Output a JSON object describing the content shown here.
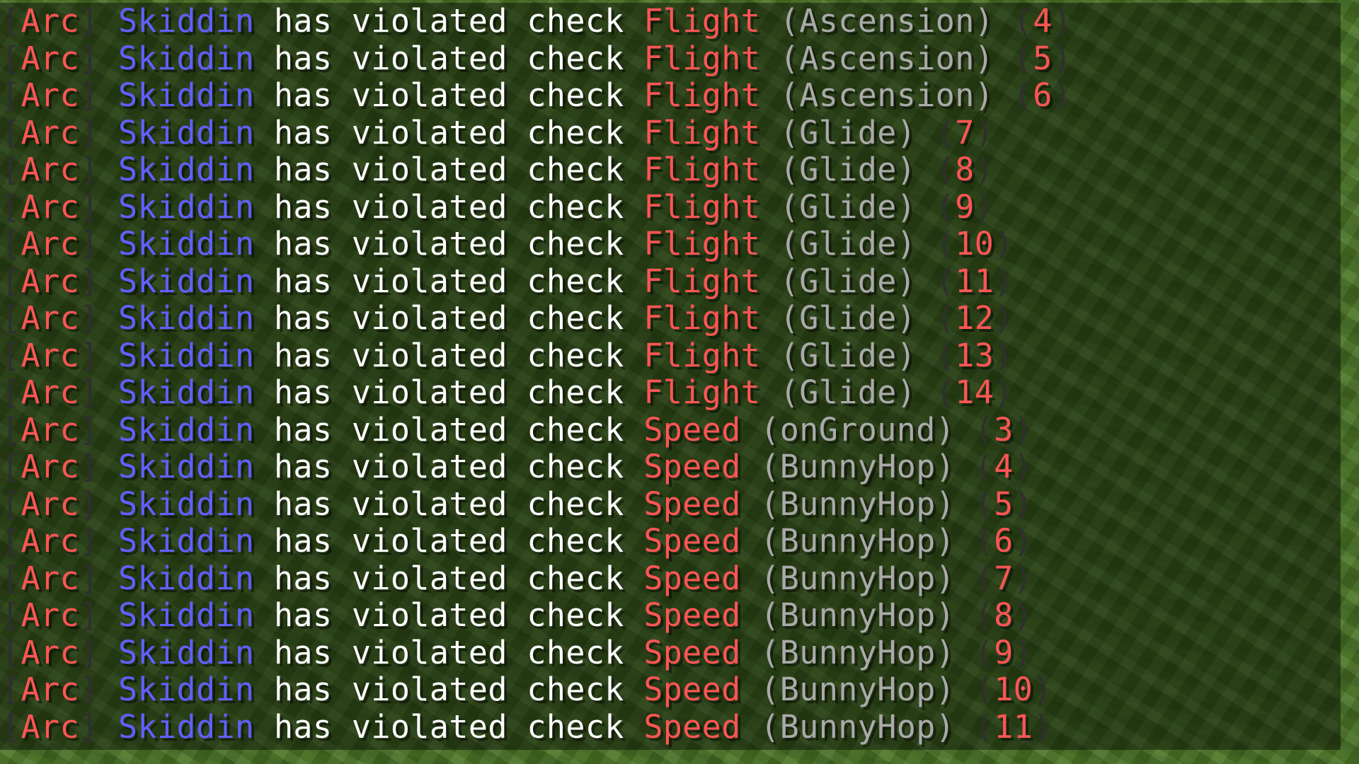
{
  "chat": {
    "lines": [
      {
        "prefix": "Arc",
        "player": "Skiddin",
        "message": "has violated check",
        "check": "Flight",
        "detail": "(Ascension)",
        "vl": "4"
      },
      {
        "prefix": "Arc",
        "player": "Skiddin",
        "message": "has violated check",
        "check": "Flight",
        "detail": "(Ascension)",
        "vl": "5"
      },
      {
        "prefix": "Arc",
        "player": "Skiddin",
        "message": "has violated check",
        "check": "Flight",
        "detail": "(Ascension)",
        "vl": "6"
      },
      {
        "prefix": "Arc",
        "player": "Skiddin",
        "message": "has violated check",
        "check": "Flight",
        "detail": "(Glide)",
        "vl": "7"
      },
      {
        "prefix": "Arc",
        "player": "Skiddin",
        "message": "has violated check",
        "check": "Flight",
        "detail": "(Glide)",
        "vl": "8"
      },
      {
        "prefix": "Arc",
        "player": "Skiddin",
        "message": "has violated check",
        "check": "Flight",
        "detail": "(Glide)",
        "vl": "9"
      },
      {
        "prefix": "Arc",
        "player": "Skiddin",
        "message": "has violated check",
        "check": "Flight",
        "detail": "(Glide)",
        "vl": "10"
      },
      {
        "prefix": "Arc",
        "player": "Skiddin",
        "message": "has violated check",
        "check": "Flight",
        "detail": "(Glide)",
        "vl": "11"
      },
      {
        "prefix": "Arc",
        "player": "Skiddin",
        "message": "has violated check",
        "check": "Flight",
        "detail": "(Glide)",
        "vl": "12"
      },
      {
        "prefix": "Arc",
        "player": "Skiddin",
        "message": "has violated check",
        "check": "Flight",
        "detail": "(Glide)",
        "vl": "13"
      },
      {
        "prefix": "Arc",
        "player": "Skiddin",
        "message": "has violated check",
        "check": "Flight",
        "detail": "(Glide)",
        "vl": "14"
      },
      {
        "prefix": "Arc",
        "player": "Skiddin",
        "message": "has violated check",
        "check": "Speed",
        "detail": "(onGround)",
        "vl": "3"
      },
      {
        "prefix": "Arc",
        "player": "Skiddin",
        "message": "has violated check",
        "check": "Speed",
        "detail": "(BunnyHop)",
        "vl": "4"
      },
      {
        "prefix": "Arc",
        "player": "Skiddin",
        "message": "has violated check",
        "check": "Speed",
        "detail": "(BunnyHop)",
        "vl": "5"
      },
      {
        "prefix": "Arc",
        "player": "Skiddin",
        "message": "has violated check",
        "check": "Speed",
        "detail": "(BunnyHop)",
        "vl": "6"
      },
      {
        "prefix": "Arc",
        "player": "Skiddin",
        "message": "has violated check",
        "check": "Speed",
        "detail": "(BunnyHop)",
        "vl": "7"
      },
      {
        "prefix": "Arc",
        "player": "Skiddin",
        "message": "has violated check",
        "check": "Speed",
        "detail": "(BunnyHop)",
        "vl": "8"
      },
      {
        "prefix": "Arc",
        "player": "Skiddin",
        "message": "has violated check",
        "check": "Speed",
        "detail": "(BunnyHop)",
        "vl": "9"
      },
      {
        "prefix": "Arc",
        "player": "Skiddin",
        "message": "has violated check",
        "check": "Speed",
        "detail": "(BunnyHop)",
        "vl": "10"
      },
      {
        "prefix": "Arc",
        "player": "Skiddin",
        "message": "has violated check",
        "check": "Speed",
        "detail": "(BunnyHop)",
        "vl": "11"
      }
    ]
  },
  "colors": {
    "prefix": "#ff5555",
    "player": "#5555ff",
    "message": "#ffffff",
    "check": "#ff5555",
    "detail": "#aaaaaa",
    "vl": "#ff5555",
    "brackets": "#333333",
    "grass": "#4a7426"
  }
}
